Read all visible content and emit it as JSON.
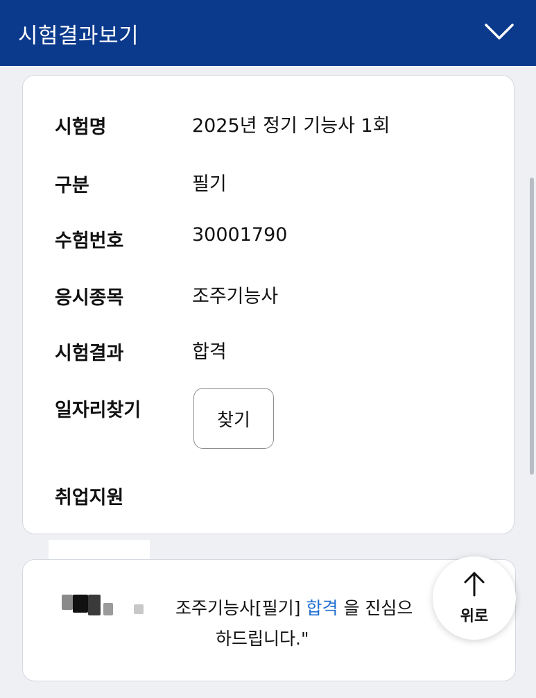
{
  "header": {
    "title": "시험결과보기",
    "toggle_icon": "chevron-down-icon"
  },
  "result": {
    "rows": [
      {
        "label": "시험명",
        "value": "2025년 정기 기능사 1회"
      },
      {
        "label": "구분",
        "value": "필기"
      },
      {
        "label": "수험번호",
        "value": "30001790"
      },
      {
        "label": "응시종목",
        "value": "조주기능사"
      },
      {
        "label": "시험결과",
        "value": "합격"
      },
      {
        "label": "일자리찾기",
        "value": ""
      },
      {
        "label": "취업지원",
        "value": ""
      }
    ],
    "find_button_label": "찾기"
  },
  "message": {
    "part1": "조주기능사[필기]",
    "highlight": "합격",
    "part2": "을 진심으",
    "line2": "하드립니다.\""
  },
  "scroll_top": {
    "label": "위로",
    "icon": "arrow-up-icon"
  },
  "colors": {
    "header_bg": "#0b3a8c",
    "highlight": "#1f6fd1"
  }
}
